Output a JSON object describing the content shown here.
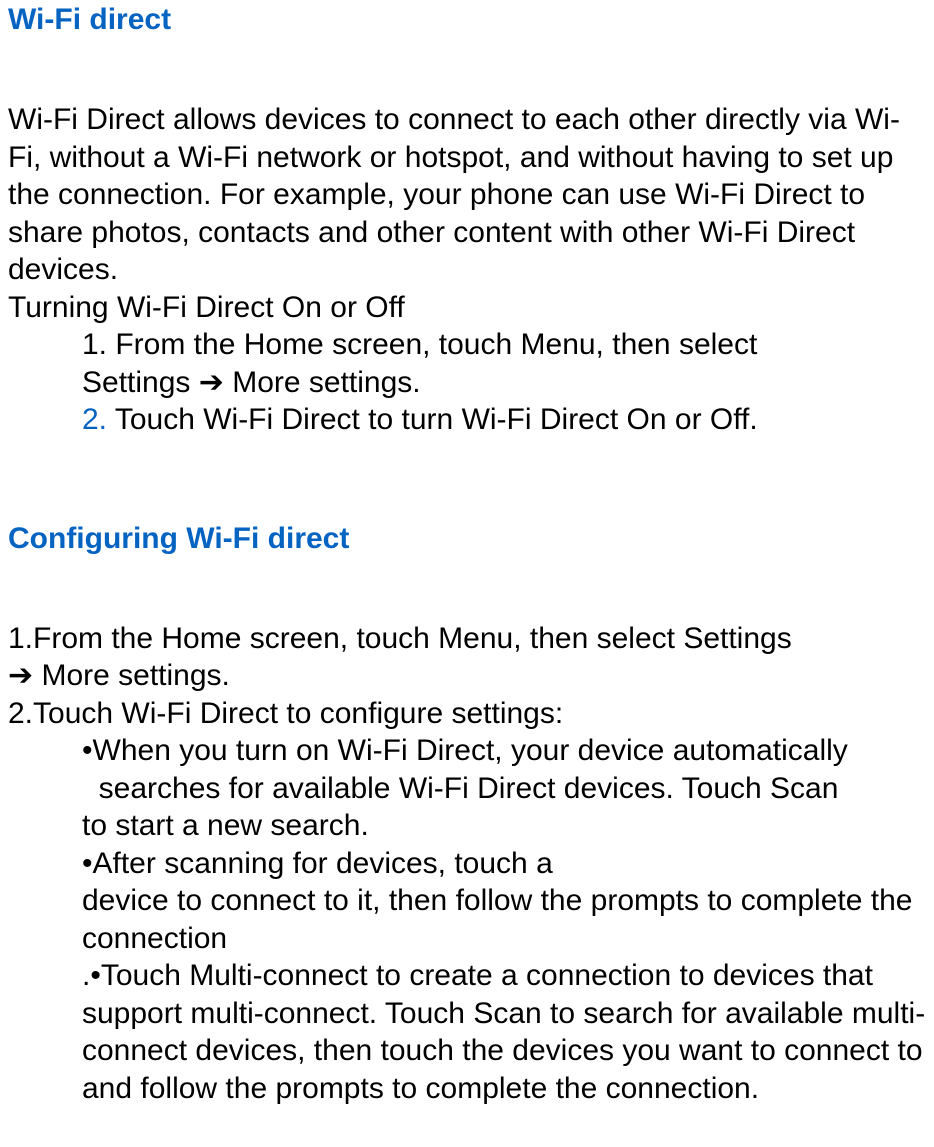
{
  "section1": {
    "title": "Wi-Fi direct",
    "p1": "Wi-Fi Direct allows devices to connect to each other directly via Wi-Fi, without a Wi-Fi network or hotspot, and without having to set up the connection. For example, your phone can use Wi-Fi Direct to share photos, contacts and other content with other Wi-Fi Direct devices.",
    "p2": "Turning Wi-Fi Direct On or Off",
    "step1a": "1. From the Home screen, touch Menu, then select ",
    "step1b": "Settings  ➔  More settings.",
    "step2_num": "2.",
    "step2_text": " Touch Wi-Fi Direct    to turn Wi-Fi Direct On or Off."
  },
  "section2": {
    "title": "Configuring Wi-Fi direct",
    "p1a": "1.From the Home screen, touch    Menu, then select Settings ",
    "p1b": "➔  More settings.",
    "p2": "2.Touch Wi-Fi Direct to configure settings:",
    "b1a": "•When you turn on Wi-Fi Direct, your device automatically",
    "b1b": "  searches for available Wi-Fi Direct devices. Touch Scan ",
    "b1c": "to start a new search.",
    "b2a": "•After scanning for devices, touch a ",
    "b2b": "device to connect to it, then follow the prompts to complete the connection",
    "b3": ".•Touch Multi-connect to create a connection to devices that support multi-connect. Touch Scan to search for available multi-connect devices, then touch the devices you want to connect to and follow the prompts to complete the connection."
  }
}
